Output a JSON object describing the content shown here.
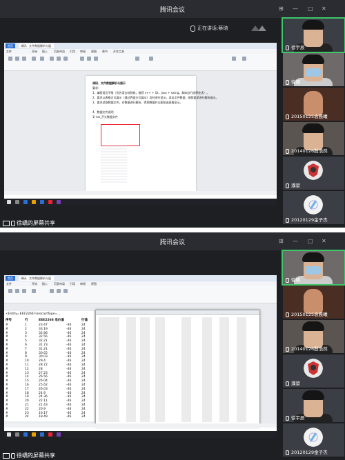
{
  "app_title": "腾讯会议",
  "speaking_label": "正在讲话:",
  "speaking_name": "蔡琦",
  "share_label": "徐嶠的屏幕共享",
  "panels": [
    {
      "participants": [
        {
          "name": "徐宇辰",
          "active": true
        },
        {
          "name": "徐嶠",
          "active": false
        },
        {
          "name": "20150125袁晨曦",
          "active": false
        },
        {
          "name": "20140126殷浩然",
          "active": false
        },
        {
          "name": "濮堃",
          "active": false
        },
        {
          "name": "20120129金子杰",
          "active": false
        }
      ],
      "doc": {
        "lines": [
          "调研、文件数据解析与展示",
          "要求：",
          "1、编程语言不限（优先语言较熟练，推荐 c++ + Qt，java + swing，具体自行选择技术）。",
          "2、要求以表格方式展示（通过界面方式展示）及时进行显示。读出文件数据，按照要求进行解析展示。",
          "3、要求读取数据文件，对数据进行解析，得到数据并以图形或表格显示。",
          "4、数据文件说明",
          "1) txt_开头数据文件"
        ]
      }
    },
    {
      "participants": [
        {
          "name": "徐嶠",
          "active": true
        },
        {
          "name": "20150125袁晨曦",
          "active": false
        },
        {
          "name": "20140126殷浩然",
          "active": false
        },
        {
          "name": "濮堃",
          "active": false
        },
        {
          "name": "徐宇辰",
          "active": false
        },
        {
          "name": "20120129金子杰",
          "active": false
        }
      ],
      "table": {
        "header_line": "<Entity=EEE2266 ForecastType=...",
        "columns": [
          "序号",
          "行",
          "EEE2266 电价值",
          "行值"
        ],
        "rows": [
          [
            "#",
            "1",
            "23.47",
            "-46",
            "24"
          ],
          [
            "#",
            "2",
            "33.19",
            "-46",
            "24"
          ],
          [
            "#",
            "3",
            "32.86",
            "-46",
            "24"
          ],
          [
            "#",
            "4",
            "32.56",
            "-46",
            "24"
          ],
          [
            "#",
            "5",
            "32.21",
            "-46",
            "24"
          ],
          [
            "#",
            "6",
            "31.73",
            "-46",
            "24"
          ],
          [
            "#",
            "7",
            "31.21",
            "-46",
            "24"
          ],
          [
            "#",
            "8",
            "30.65",
            "-46",
            "24"
          ],
          [
            "#",
            "9",
            "30.03",
            "-46",
            "24"
          ],
          [
            "#",
            "10",
            "29.4",
            "-46",
            "24"
          ],
          [
            "#",
            "11",
            "28.72",
            "-46",
            "24"
          ],
          [
            "#",
            "12",
            "28",
            "-46",
            "24"
          ],
          [
            "#",
            "13",
            "27.23",
            "-46",
            "24"
          ],
          [
            "#",
            "14",
            "26.56",
            "-46",
            "24"
          ],
          [
            "#",
            "15",
            "26.04",
            "-46",
            "24"
          ],
          [
            "#",
            "16",
            "25.62",
            "-46",
            "24"
          ],
          [
            "#",
            "17",
            "26.03",
            "-46",
            "24"
          ],
          [
            "#",
            "18",
            "24.9",
            "-46",
            "24"
          ],
          [
            "#",
            "19",
            "24.36",
            "-46",
            "24"
          ],
          [
            "#",
            "20",
            "22.11",
            "-46",
            "24"
          ],
          [
            "#",
            "21",
            "21.43",
            "-46",
            "24"
          ],
          [
            "#",
            "22",
            "20.9",
            "-46",
            "24"
          ],
          [
            "#",
            "23",
            "19.17",
            "-46",
            "24"
          ],
          [
            "#",
            "24",
            "18.49",
            "-46",
            "24"
          ]
        ]
      }
    }
  ],
  "colors": {
    "accent_green": "#3ec66a",
    "background": "#1d1f23",
    "highlight_red": "#e22233"
  }
}
